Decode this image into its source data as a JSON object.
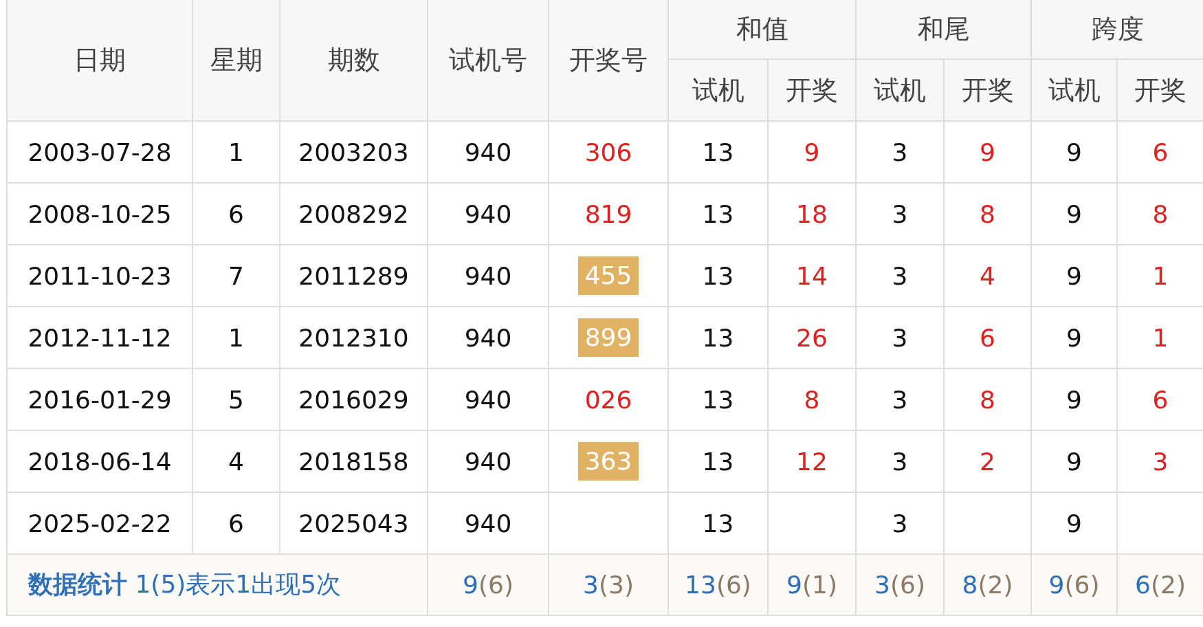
{
  "table": {
    "header_rows": [
      [
        {
          "label": "日期",
          "rowspan": 2
        },
        {
          "label": "星期",
          "rowspan": 2
        },
        {
          "label": "期数",
          "rowspan": 2
        },
        {
          "label": "试机号",
          "rowspan": 2
        },
        {
          "label": "开奖号",
          "rowspan": 2
        },
        {
          "label": "和值",
          "colspan": 2
        },
        {
          "label": "和尾",
          "colspan": 2
        },
        {
          "label": "跨度",
          "colspan": 2
        }
      ],
      [
        {
          "label": "试机"
        },
        {
          "label": "开奖"
        },
        {
          "label": "试机"
        },
        {
          "label": "开奖"
        },
        {
          "label": "试机"
        },
        {
          "label": "开奖"
        }
      ]
    ],
    "rows": [
      {
        "cells": [
          {
            "kind": "plain",
            "text": "2003-07-28"
          },
          {
            "kind": "plain",
            "text": "1"
          },
          {
            "kind": "plain",
            "text": "2003203"
          },
          {
            "kind": "plain",
            "text": "940"
          },
          {
            "kind": "red",
            "text": "306"
          },
          {
            "kind": "plain",
            "text": "13"
          },
          {
            "kind": "red",
            "text": "9"
          },
          {
            "kind": "plain",
            "text": "3"
          },
          {
            "kind": "red",
            "text": "9"
          },
          {
            "kind": "plain",
            "text": "9"
          },
          {
            "kind": "red",
            "text": "6"
          }
        ]
      },
      {
        "cells": [
          {
            "kind": "plain",
            "text": "2008-10-25"
          },
          {
            "kind": "plain",
            "text": "6"
          },
          {
            "kind": "plain",
            "text": "2008292"
          },
          {
            "kind": "plain",
            "text": "940"
          },
          {
            "kind": "red",
            "text": "819"
          },
          {
            "kind": "plain",
            "text": "13"
          },
          {
            "kind": "red",
            "text": "18"
          },
          {
            "kind": "plain",
            "text": "3"
          },
          {
            "kind": "red",
            "text": "8"
          },
          {
            "kind": "plain",
            "text": "9"
          },
          {
            "kind": "red",
            "text": "8"
          }
        ]
      },
      {
        "cells": [
          {
            "kind": "plain",
            "text": "2011-10-23"
          },
          {
            "kind": "plain",
            "text": "7"
          },
          {
            "kind": "plain",
            "text": "2011289"
          },
          {
            "kind": "plain",
            "text": "940"
          },
          {
            "kind": "badge",
            "text": "455"
          },
          {
            "kind": "plain",
            "text": "13"
          },
          {
            "kind": "red",
            "text": "14"
          },
          {
            "kind": "plain",
            "text": "3"
          },
          {
            "kind": "red",
            "text": "4"
          },
          {
            "kind": "plain",
            "text": "9"
          },
          {
            "kind": "red",
            "text": "1"
          }
        ]
      },
      {
        "cells": [
          {
            "kind": "plain",
            "text": "2012-11-12"
          },
          {
            "kind": "plain",
            "text": "1"
          },
          {
            "kind": "plain",
            "text": "2012310"
          },
          {
            "kind": "plain",
            "text": "940"
          },
          {
            "kind": "badge",
            "text": "899"
          },
          {
            "kind": "plain",
            "text": "13"
          },
          {
            "kind": "red",
            "text": "26"
          },
          {
            "kind": "plain",
            "text": "3"
          },
          {
            "kind": "red",
            "text": "6"
          },
          {
            "kind": "plain",
            "text": "9"
          },
          {
            "kind": "red",
            "text": "1"
          }
        ]
      },
      {
        "cells": [
          {
            "kind": "plain",
            "text": "2016-01-29"
          },
          {
            "kind": "plain",
            "text": "5"
          },
          {
            "kind": "plain",
            "text": "2016029"
          },
          {
            "kind": "plain",
            "text": "940"
          },
          {
            "kind": "red",
            "text": "026"
          },
          {
            "kind": "plain",
            "text": "13"
          },
          {
            "kind": "red",
            "text": "8"
          },
          {
            "kind": "plain",
            "text": "3"
          },
          {
            "kind": "red",
            "text": "8"
          },
          {
            "kind": "plain",
            "text": "9"
          },
          {
            "kind": "red",
            "text": "6"
          }
        ]
      },
      {
        "cells": [
          {
            "kind": "plain",
            "text": "2018-06-14"
          },
          {
            "kind": "plain",
            "text": "4"
          },
          {
            "kind": "plain",
            "text": "2018158"
          },
          {
            "kind": "plain",
            "text": "940"
          },
          {
            "kind": "badge",
            "text": "363"
          },
          {
            "kind": "plain",
            "text": "13"
          },
          {
            "kind": "red",
            "text": "12"
          },
          {
            "kind": "plain",
            "text": "3"
          },
          {
            "kind": "red",
            "text": "2"
          },
          {
            "kind": "plain",
            "text": "9"
          },
          {
            "kind": "red",
            "text": "3"
          }
        ]
      },
      {
        "cells": [
          {
            "kind": "plain",
            "text": "2025-02-22"
          },
          {
            "kind": "plain",
            "text": "6"
          },
          {
            "kind": "plain",
            "text": "2025043"
          },
          {
            "kind": "plain",
            "text": "940"
          },
          {
            "kind": "empty"
          },
          {
            "kind": "plain",
            "text": "13"
          },
          {
            "kind": "empty"
          },
          {
            "kind": "plain",
            "text": "3"
          },
          {
            "kind": "empty"
          },
          {
            "kind": "plain",
            "text": "9"
          },
          {
            "kind": "empty"
          }
        ]
      }
    ],
    "footer": {
      "label": "数据统计",
      "note": "1(5)表示1出现5次",
      "stats": [
        {
          "value": "9",
          "count": "(6)"
        },
        {
          "value": "3",
          "count": "(3)"
        },
        {
          "value": "13",
          "count": "(6)"
        },
        {
          "value": "9",
          "count": "(1)"
        },
        {
          "value": "3",
          "count": "(6)"
        },
        {
          "value": "8",
          "count": "(2)"
        },
        {
          "value": "9",
          "count": "(6)"
        },
        {
          "value": "6",
          "count": "(2)"
        }
      ]
    }
  }
}
